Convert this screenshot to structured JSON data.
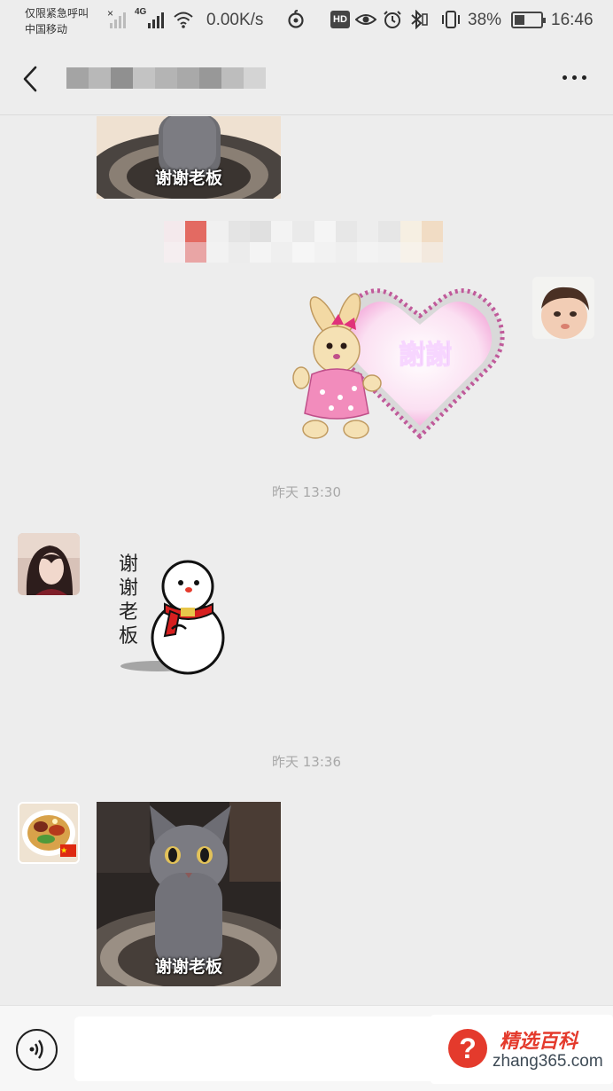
{
  "status_bar": {
    "carrier_line1": "仅限紧急呼叫",
    "carrier_line2": "中国移动",
    "network_tag": "4G",
    "network_speed": "0.00K/s",
    "hd_badge": "HD",
    "battery_percent": "38%",
    "battery_level": 0.38,
    "time": "16:46",
    "icons": [
      "signal-bars-icon",
      "wifi-icon",
      "netease-music-icon",
      "eye-icon",
      "alarm-icon",
      "bluetooth-icon",
      "vibrate-icon",
      "battery-icon"
    ]
  },
  "header": {
    "back_icon": "chevron-left-icon",
    "title": "",
    "more_icon": "more-dots-icon"
  },
  "messages": [
    {
      "id": "m1",
      "side": "left",
      "kind": "sticker",
      "sticker": "cat-thanks-boss",
      "caption": "谢谢老板"
    },
    {
      "id": "m2",
      "kind": "blurred-banner"
    },
    {
      "id": "m3",
      "side": "right",
      "kind": "sticker",
      "sticker": "bunny-heart",
      "caption": "謝謝"
    },
    {
      "id": "t1",
      "kind": "timestamp",
      "text": "昨天 13:30"
    },
    {
      "id": "m4",
      "side": "left",
      "kind": "sticker",
      "sticker": "snowman",
      "caption_chars": [
        "谢",
        "谢",
        "老",
        "板"
      ]
    },
    {
      "id": "t2",
      "kind": "timestamp",
      "text": "昨天 13:36"
    },
    {
      "id": "m5",
      "side": "left",
      "kind": "sticker",
      "sticker": "cat-thanks-boss",
      "caption": "谢谢老板"
    }
  ],
  "input_bar": {
    "voice_icon": "voice-input-icon",
    "text_value": ""
  },
  "watermark": {
    "mark": "?",
    "name": "精选百科",
    "url": "zhang365.com"
  },
  "colors": {
    "background": "#ededed",
    "watermark_red": "#e43a2c",
    "heart_pink": "#e98ac4",
    "heart_text": "#a01ed0",
    "snowman_scarf": "#d71f1f"
  }
}
